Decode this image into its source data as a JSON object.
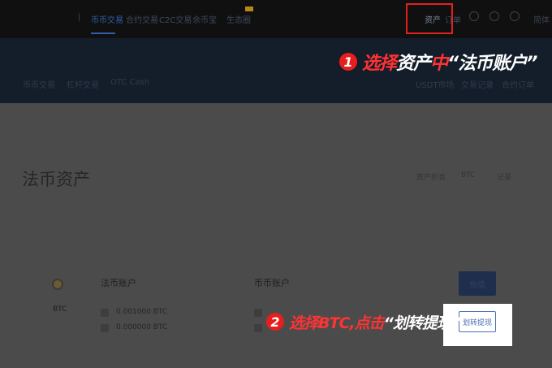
{
  "topnav": {
    "items": [
      {
        "label": "币币交易",
        "active": true
      },
      {
        "label": "合约交易",
        "active": false
      },
      {
        "label": "C2C交易",
        "active": false
      },
      {
        "label": "余币宝",
        "active": false
      },
      {
        "label": "生态圈",
        "active": false
      }
    ],
    "assets": "资产",
    "orders": "订单",
    "right_text": "简体"
  },
  "subnav": {
    "left": [
      "币币交易",
      "杠杆交易",
      "OTC Cash"
    ],
    "right": [
      "USDT市场",
      "交易记录",
      "合约订单"
    ]
  },
  "annotation1": {
    "number": "1",
    "red_text": "选择",
    "white_text": "资产",
    "red_text2": "中",
    "quoted": "“法币账户”"
  },
  "page": {
    "title": "法币资产",
    "crumbs": [
      "资产折合",
      "BTC",
      "记录"
    ]
  },
  "asset_row": {
    "coin": "BTC",
    "fiat_account_header": "法币账户",
    "coin_account_header": "币币账户",
    "balances": [
      "0.001000 BTC",
      "0.000000 BTC"
    ],
    "top_button": "充值",
    "transfer_button": "划转提现"
  },
  "annotation2": {
    "number": "2",
    "red_text": "选择BTC,点击",
    "white_text": "“划转提现”"
  },
  "colors": {
    "annotation_red": "#e81e1e",
    "brand_blue": "#2f5fa8"
  }
}
